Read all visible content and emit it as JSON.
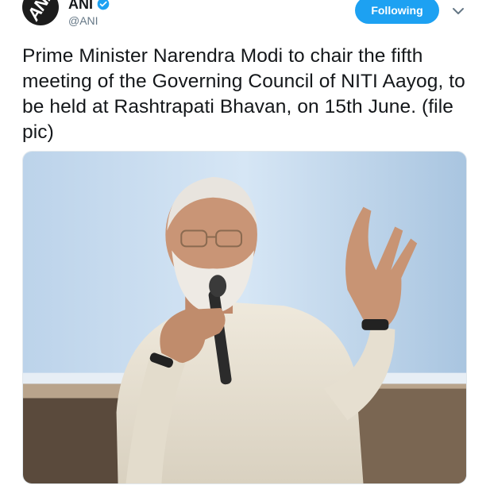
{
  "author": {
    "display_name": "ANI",
    "handle": "@ANI",
    "verified": true,
    "avatar_text": "ANI",
    "avatar_icon": "ani-logo"
  },
  "actions": {
    "follow_label": "Following",
    "more_icon": "chevron-down-icon"
  },
  "tweet": {
    "text": "Prime Minister Narendra Modi to chair the fifth meeting of the Governing Council of NITI Aayog, to be held at Rashtrapati Bhavan, on 15th June. (file pic)"
  },
  "colors": {
    "accent": "#1da1f2",
    "text": "#14171a",
    "muted": "#657786"
  }
}
